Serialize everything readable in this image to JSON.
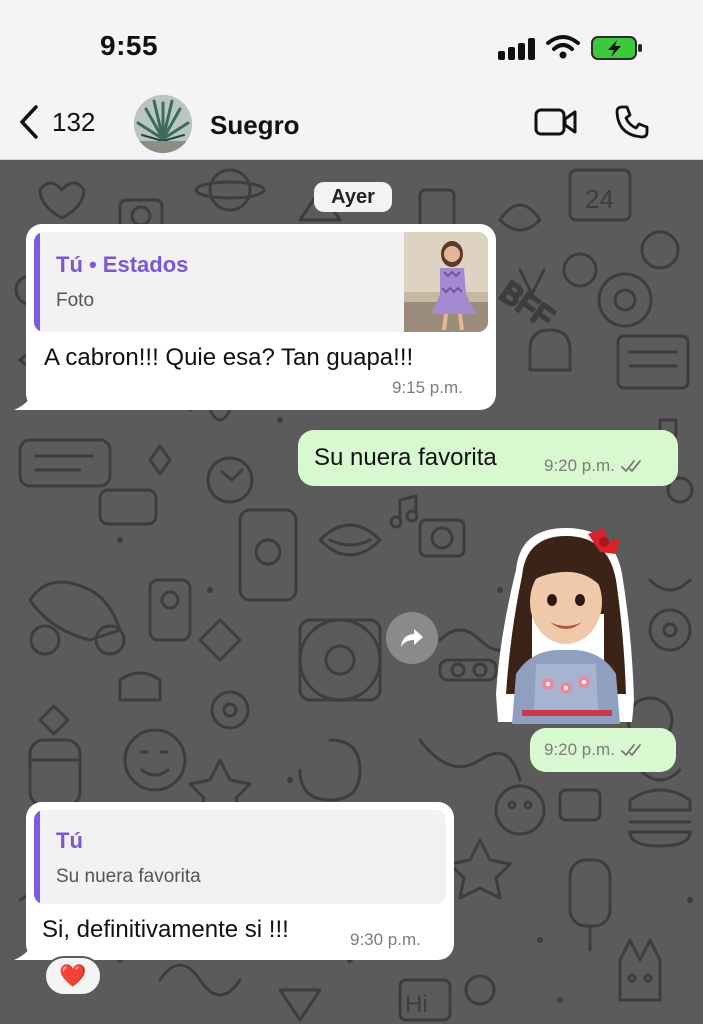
{
  "status_bar": {
    "time": "9:55"
  },
  "header": {
    "back_count": "132",
    "contact_name": "Suegro"
  },
  "chat": {
    "day_label": "Ayer",
    "messages": [
      {
        "direction": "incoming",
        "quote": {
          "title": "Tú • Estados",
          "subtitle": "Foto"
        },
        "text": "A cabron!!! Quie esa? Tan guapa!!!",
        "time": "9:15 p.m."
      },
      {
        "direction": "outgoing",
        "text": "Su nuera favorita",
        "time": "9:20 p.m."
      },
      {
        "direction": "outgoing",
        "type": "sticker",
        "time": "9:20 p.m."
      },
      {
        "direction": "incoming",
        "quote": {
          "title": "Tú",
          "subtitle": "Su nuera favorita"
        },
        "text": "Si, definitivamente si !!!",
        "time": "9:30 p.m.",
        "reaction": "❤️"
      }
    ]
  },
  "colors": {
    "outgoing_bubble": "#d8f9cf",
    "incoming_bubble": "#ffffff",
    "quote_accent": "#7e5ae0",
    "wallpaper": "#5b5b5b",
    "battery_charging": "#3ec93c"
  },
  "icons": [
    "back-chevron-icon",
    "video-call-icon",
    "phone-icon",
    "forward-icon",
    "double-check-icon",
    "signal-icon",
    "wifi-icon",
    "battery-icon",
    "heart-icon"
  ]
}
